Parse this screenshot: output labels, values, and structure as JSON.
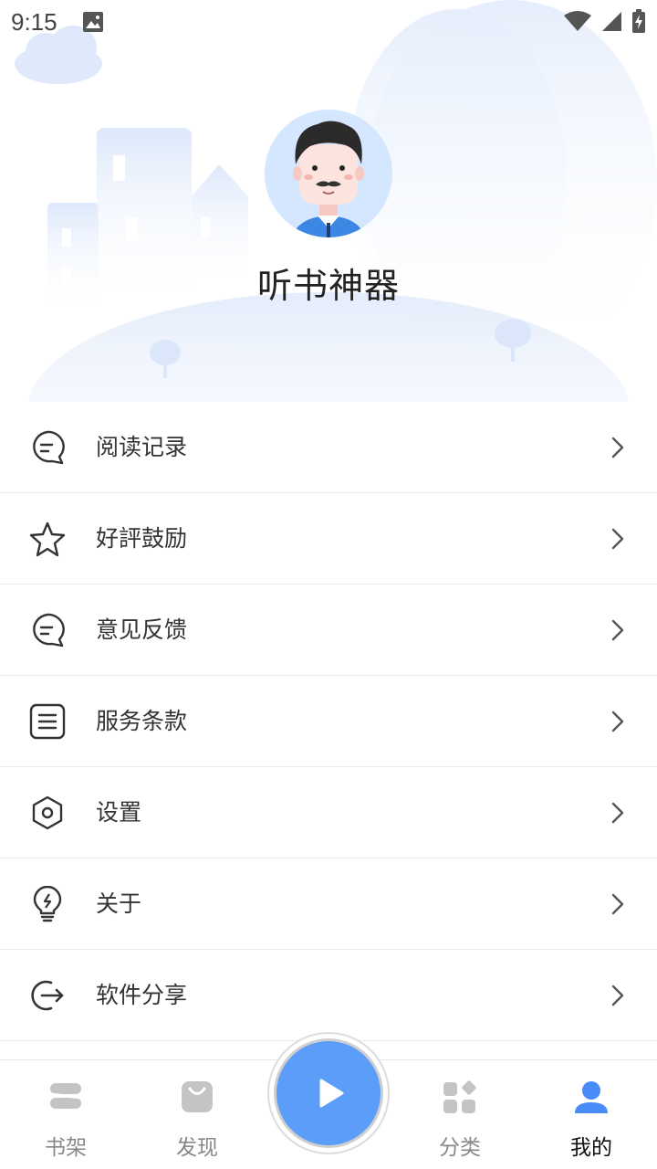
{
  "status_bar": {
    "time": "9:15"
  },
  "profile": {
    "username": "听书神器"
  },
  "menu": [
    {
      "label": "阅读记录",
      "icon": "chat-bubble-icon"
    },
    {
      "label": "好評鼓励",
      "icon": "star-icon"
    },
    {
      "label": "意见反馈",
      "icon": "chat-bubble-icon"
    },
    {
      "label": "服务条款",
      "icon": "document-list-icon"
    },
    {
      "label": "设置",
      "icon": "hexagon-settings-icon"
    },
    {
      "label": "关于",
      "icon": "lightbulb-icon"
    },
    {
      "label": "软件分享",
      "icon": "share-exit-icon"
    }
  ],
  "bottom_nav": [
    {
      "label": "书架",
      "icon": "bookshelf-icon",
      "active": false
    },
    {
      "label": "发现",
      "icon": "shopping-bag-icon",
      "active": false
    },
    {
      "label": "",
      "icon": "play-icon",
      "active": false
    },
    {
      "label": "分类",
      "icon": "category-grid-icon",
      "active": false
    },
    {
      "label": "我的",
      "icon": "person-icon",
      "active": true
    }
  ],
  "colors": {
    "accent": "#5b9df8",
    "active_nav": "#4a8cf7",
    "inactive_nav": "#c4c4c4"
  }
}
